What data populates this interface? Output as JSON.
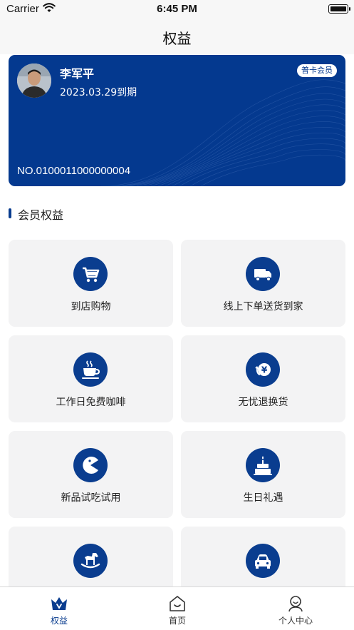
{
  "status_bar": {
    "carrier": "Carrier",
    "time": "6:45 PM",
    "wifi_icon": "wifi-icon",
    "battery_icon": "battery-icon"
  },
  "nav": {
    "title": "权益"
  },
  "member_card": {
    "name": "李军平",
    "expiry": "2023.03.29到期",
    "level_badge": "普卡会员",
    "card_number": "NO.0100011000000004",
    "background_color": "#04398f"
  },
  "section": {
    "title": "会员权益"
  },
  "benefits": [
    {
      "label": "到店购物",
      "icon": "shopping-cart-icon"
    },
    {
      "label": "线上下单送货到家",
      "icon": "delivery-truck-icon"
    },
    {
      "label": "工作日免费咖啡",
      "icon": "coffee-cup-icon"
    },
    {
      "label": "无忧退换货",
      "icon": "yen-exchange-icon"
    },
    {
      "label": "新品试吃试用",
      "icon": "pacman-icon"
    },
    {
      "label": "生日礼遇",
      "icon": "birthday-cake-icon"
    },
    {
      "label": "",
      "icon": "rocking-horse-icon"
    },
    {
      "label": "",
      "icon": "car-icon"
    }
  ],
  "tabbar": {
    "tabs": [
      {
        "label": "权益",
        "icon": "crown-icon",
        "active": true
      },
      {
        "label": "首页",
        "icon": "home-icon",
        "active": false
      },
      {
        "label": "个人中心",
        "icon": "user-icon",
        "active": false
      }
    ]
  },
  "colors": {
    "brand": "#0a3d8f",
    "tile_bg": "#f3f3f4"
  }
}
